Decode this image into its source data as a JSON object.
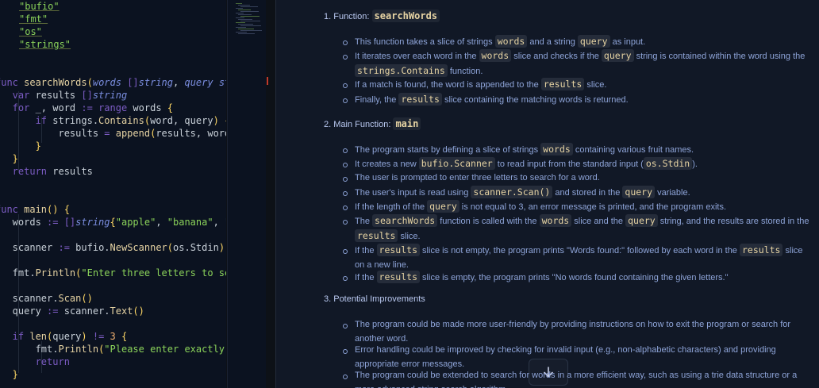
{
  "editor": {
    "lines": [
      [
        [
          "t-str",
          "\"bufio\""
        ]
      ],
      [
        [
          "t-str",
          "\"fmt\""
        ]
      ],
      [
        [
          "t-str",
          "\"os\""
        ]
      ],
      [
        [
          "t-str",
          "\"strings\""
        ]
      ],
      [],
      [],
      [
        [
          "t-kw",
          "func "
        ],
        [
          "t-fn",
          "searchWords"
        ],
        [
          "t-pun",
          "("
        ],
        [
          "t-ty",
          "words "
        ],
        [
          "t-op",
          "[]"
        ],
        [
          "t-ty",
          "string"
        ],
        [
          "t-id",
          ", "
        ],
        [
          "t-ty",
          "query str"
        ]
      ],
      [
        [
          "t-kw",
          "   var "
        ],
        [
          "t-id",
          "results "
        ],
        [
          "t-op",
          "[]"
        ],
        [
          "t-ty",
          "string"
        ]
      ],
      [
        [
          "t-kw",
          "   for "
        ],
        [
          "t-id",
          "_, word "
        ],
        [
          "t-op",
          ":= "
        ],
        [
          "t-kw",
          "range "
        ],
        [
          "t-id",
          "words "
        ],
        [
          "t-pun",
          "{"
        ]
      ],
      [
        [
          "t-kw",
          "       if "
        ],
        [
          "t-id",
          "strings."
        ],
        [
          "t-fn",
          "Contains"
        ],
        [
          "t-pun",
          "("
        ],
        [
          "t-id",
          "word, query"
        ],
        [
          "t-pun",
          ") {"
        ]
      ],
      [
        [
          "t-id",
          "           results "
        ],
        [
          "t-op",
          "= "
        ],
        [
          "t-fn",
          "append"
        ],
        [
          "t-pun",
          "("
        ],
        [
          "t-id",
          "results, word"
        ]
      ],
      [
        [
          "t-pun",
          "       }"
        ]
      ],
      [
        [
          "t-pun",
          "   }"
        ]
      ],
      [
        [
          "t-kw",
          "   return "
        ],
        [
          "t-id",
          "results"
        ]
      ],
      [
        [
          "t-pun",
          "}"
        ]
      ],
      [],
      [
        [
          "t-kw",
          "func "
        ],
        [
          "t-fn",
          "main"
        ],
        [
          "t-pun",
          "() {"
        ]
      ],
      [
        [
          "t-id",
          "   words "
        ],
        [
          "t-op",
          ":= []"
        ],
        [
          "t-ty",
          "string"
        ],
        [
          "t-pun",
          "{"
        ],
        [
          "t-str2",
          "\"apple\""
        ],
        [
          "t-id",
          ", "
        ],
        [
          "t-str2",
          "\"banana\""
        ],
        [
          "t-id",
          ", \""
        ]
      ],
      [],
      [
        [
          "t-id",
          "   scanner "
        ],
        [
          "t-op",
          ":= "
        ],
        [
          "t-id",
          "bufio."
        ],
        [
          "t-fn",
          "NewScanner"
        ],
        [
          "t-pun",
          "("
        ],
        [
          "t-id",
          "os.Stdin"
        ],
        [
          "t-pun",
          ")"
        ]
      ],
      [],
      [
        [
          "t-id",
          "   fmt."
        ],
        [
          "t-fn",
          "Println"
        ],
        [
          "t-pun",
          "("
        ],
        [
          "t-str2",
          "\"Enter three letters to se"
        ]
      ],
      [],
      [
        [
          "t-id",
          "   scanner."
        ],
        [
          "t-fn",
          "Scan"
        ],
        [
          "t-pun",
          "()"
        ]
      ],
      [
        [
          "t-id",
          "   query "
        ],
        [
          "t-op",
          ":= "
        ],
        [
          "t-id",
          "scanner."
        ],
        [
          "t-fn",
          "Text"
        ],
        [
          "t-pun",
          "()"
        ]
      ],
      [],
      [
        [
          "t-kw",
          "   if "
        ],
        [
          "t-fn",
          "len"
        ],
        [
          "t-pun",
          "("
        ],
        [
          "t-id",
          "query"
        ],
        [
          "t-pun",
          ") "
        ],
        [
          "t-op",
          "!= "
        ],
        [
          "t-num",
          "3 "
        ],
        [
          "t-pun",
          "{"
        ]
      ],
      [
        [
          "t-id",
          "       fmt."
        ],
        [
          "t-fn",
          "Println"
        ],
        [
          "t-pun",
          "("
        ],
        [
          "t-str2",
          "\"Please enter exactly "
        ]
      ],
      [
        [
          "t-kw",
          "       return"
        ]
      ],
      [
        [
          "t-pun",
          "   }"
        ]
      ]
    ]
  },
  "chat": {
    "sections": [
      {
        "number": "1. Function: ",
        "code": "searchWords",
        "items": [
          [
            [
              "t",
              "This function takes a slice of strings "
            ],
            [
              "c",
              "words"
            ],
            [
              "t",
              " and a string "
            ],
            [
              "c",
              "query"
            ],
            [
              "t",
              " as input."
            ]
          ],
          [
            [
              "t",
              "It iterates over each word in the "
            ],
            [
              "c",
              "words"
            ],
            [
              "t",
              " slice and checks if the "
            ],
            [
              "c",
              "query"
            ],
            [
              "t",
              " string is contained within the word using the "
            ],
            [
              "c",
              "strings.Contains"
            ],
            [
              "t",
              " function."
            ]
          ],
          [
            [
              "t",
              "If a match is found, the word is appended to the "
            ],
            [
              "c",
              "results"
            ],
            [
              "t",
              " slice."
            ]
          ],
          [
            [
              "t",
              "Finally, the "
            ],
            [
              "c",
              "results"
            ],
            [
              "t",
              " slice containing the matching words is returned."
            ]
          ]
        ]
      },
      {
        "number": "2. Main Function: ",
        "code": "main",
        "items": [
          [
            [
              "t",
              "The program starts by defining a slice of strings "
            ],
            [
              "c",
              "words"
            ],
            [
              "t",
              " containing various fruit names."
            ]
          ],
          [
            [
              "t",
              "It creates a new "
            ],
            [
              "c",
              "bufio.Scanner"
            ],
            [
              "t",
              " to read input from the standard input ("
            ],
            [
              "c",
              "os.Stdin"
            ],
            [
              "t",
              ")."
            ]
          ],
          [
            [
              "t",
              "The user is prompted to enter three letters to search for a word."
            ]
          ],
          [
            [
              "t",
              "The user's input is read using "
            ],
            [
              "c",
              "scanner.Scan()"
            ],
            [
              "t",
              " and stored in the "
            ],
            [
              "c",
              "query"
            ],
            [
              "t",
              " variable."
            ]
          ],
          [
            [
              "t",
              "If the length of the "
            ],
            [
              "c",
              "query"
            ],
            [
              "t",
              " is not equal to 3, an error message is printed, and the program exits."
            ]
          ],
          [
            [
              "t",
              "The "
            ],
            [
              "c",
              "searchWords"
            ],
            [
              "t",
              " function is called with the "
            ],
            [
              "c",
              "words"
            ],
            [
              "t",
              " slice and the "
            ],
            [
              "c",
              "query"
            ],
            [
              "t",
              " string, and the results are stored in the "
            ],
            [
              "c",
              "results"
            ],
            [
              "t",
              " slice."
            ]
          ],
          [
            [
              "t",
              "If the "
            ],
            [
              "c",
              "results"
            ],
            [
              "t",
              " slice is not empty, the program prints \"Words found:\" followed by each word in the "
            ],
            [
              "c",
              "results"
            ],
            [
              "t",
              " slice on a new line."
            ]
          ],
          [
            [
              "t",
              "If the "
            ],
            [
              "c",
              "results"
            ],
            [
              "t",
              " slice is empty, the program prints \"No words found containing the given letters.\""
            ]
          ]
        ]
      },
      {
        "number": "3. Potential Improvements",
        "code": "",
        "items": [
          [
            [
              "t",
              "The program could be made more user-friendly by providing instructions on how to exit the program or search for another word."
            ]
          ],
          [
            [
              "t",
              "Error handling could be improved by checking for invalid input (e.g., non-alphabetic characters) and providing appropriate error messages."
            ]
          ],
          [
            [
              "t",
              "The program could be extended to search for words in a more efficient way, such as using a trie data structure or a more advanced string search algorithm."
            ]
          ]
        ]
      }
    ],
    "scroll_button_icon": "arrow-down-icon"
  }
}
